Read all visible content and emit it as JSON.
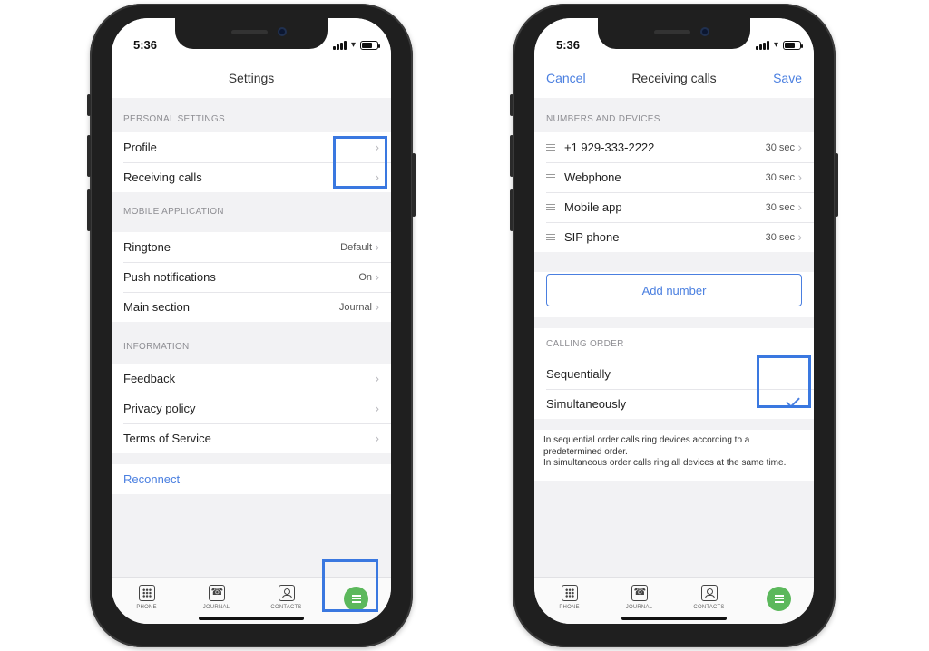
{
  "left_phone": {
    "status_time": "5:36",
    "title": "Settings",
    "sections": [
      {
        "header": "PERSONAL SETTINGS",
        "rows": [
          {
            "label": "Profile",
            "value": ""
          },
          {
            "label": "Receiving calls",
            "value": ""
          }
        ]
      },
      {
        "header": "MOBILE APPLICATION",
        "rows": [
          {
            "label": "Ringtone",
            "value": "Default"
          },
          {
            "label": "Push notifications",
            "value": "On"
          },
          {
            "label": "Main section",
            "value": "Journal"
          }
        ]
      },
      {
        "header": "INFORMATION",
        "rows": [
          {
            "label": "Feedback",
            "value": ""
          },
          {
            "label": "Privacy policy",
            "value": ""
          },
          {
            "label": "Terms of Service",
            "value": ""
          }
        ]
      }
    ],
    "reconnect": "Reconnect"
  },
  "right_phone": {
    "status_time": "5:36",
    "cancel": "Cancel",
    "title": "Receiving calls",
    "save": "Save",
    "numbers_header": "NUMBERS AND DEVICES",
    "devices": [
      {
        "label": "+1 929-333-2222",
        "timeout": "30 sec"
      },
      {
        "label": "Webphone",
        "timeout": "30 sec"
      },
      {
        "label": "Mobile app",
        "timeout": "30 sec"
      },
      {
        "label": "SIP phone",
        "timeout": "30 sec"
      }
    ],
    "add_number": "Add number",
    "calling_order_header": "CALLING ORDER",
    "order_options": [
      "Sequentially",
      "Simultaneously"
    ],
    "selected_option": "Simultaneously",
    "note_line1": "In sequential order calls ring devices according to a predetermined order.",
    "note_line2": "In simultaneous order calls ring all devices at the same time."
  },
  "tabbar": {
    "phone": "PHONE",
    "journal": "JOURNAL",
    "contacts": "CONTACTS"
  },
  "colors": {
    "accent_blue": "#4a7fe0",
    "highlight_box": "#3a78e0",
    "menu_green": "#5cb85c"
  }
}
